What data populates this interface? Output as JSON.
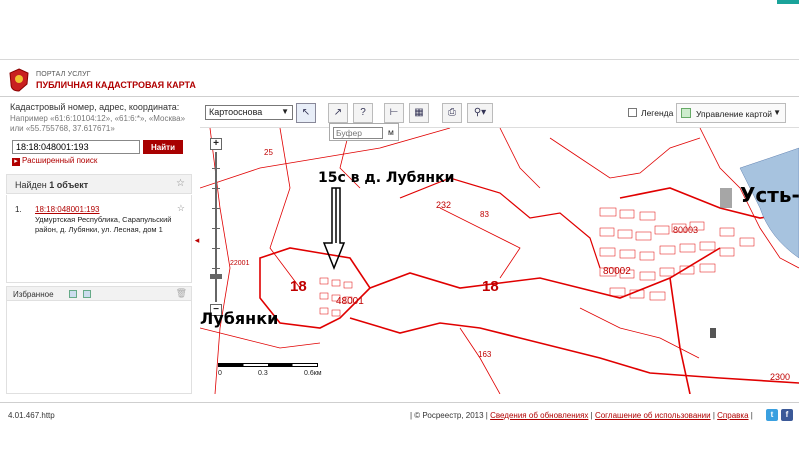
{
  "header": {
    "portal": "ПОРТАЛ УСЛУГ",
    "title": "ПУБЛИЧНАЯ КАДАСТРОВАЯ КАРТА"
  },
  "search": {
    "hint": "Кадастровый номер, адрес, координата:",
    "example": "Например «61:6:10104:12», «61:6:*», «Москва» или «55.755768, 37.617671»",
    "value": "18:18:048001:193",
    "button": "Найти",
    "advanced": "Расширенный поиск"
  },
  "results": {
    "found_prefix": "Найден",
    "found_count": "1 объект",
    "items": [
      {
        "num": "1.",
        "cad": "18:18:048001:193",
        "address": "Удмуртская Республика, Сарапульский район, д. Лубянки, ул. Лесная, дом 1"
      }
    ]
  },
  "favorites": {
    "title": "Избранное"
  },
  "toolbar": {
    "layer": "Картооснова",
    "legend": "Легенда",
    "map_control": "Управление картой",
    "buffer_placeholder": "Буфер",
    "buffer_unit": "м"
  },
  "map": {
    "annotation": "15с в д. Лубянки",
    "village_left": "Лубянки",
    "town_right": "Усть-",
    "scale_labels": [
      "0",
      "0.3",
      "0.6км"
    ],
    "labels": {
      "q18a": "18",
      "q18b": "18",
      "p48001": "48001",
      "p80002": "80002",
      "p80003": "80003",
      "p232": "232",
      "p83": "83",
      "p163": "163",
      "p2300": "2300",
      "p25": "25",
      "p22001": "22001"
    }
  },
  "footer": {
    "version": "4.01.467.http",
    "copyright": "| © Росреестр, 2013 |",
    "updates": "Сведения об обновлениях",
    "terms": "Соглашение об использовании",
    "help": "Справка"
  },
  "colors": {
    "accent": "#b00000",
    "cadastral_lines": "#e00000"
  }
}
